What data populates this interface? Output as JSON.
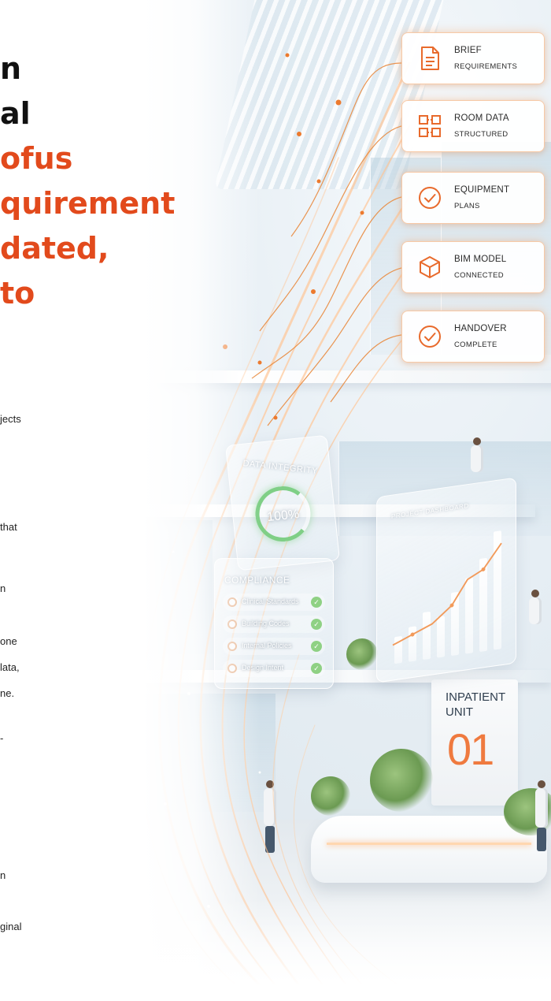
{
  "headline": {
    "lines": [
      {
        "text": "n",
        "tone": "dark"
      },
      {
        "text": "al",
        "tone": "dark"
      },
      {
        "text": "ofus",
        "tone": "orange"
      },
      {
        "text": "quirement",
        "tone": "orange"
      },
      {
        "text": "dated,",
        "tone": "orange"
      },
      {
        "text": " to",
        "tone": "orange"
      }
    ]
  },
  "body_fragments": [
    "jects",
    "that",
    "n",
    "one",
    "lata,",
    "ne.",
    "-",
    "n",
    "ginal"
  ],
  "requirement_cards": [
    {
      "title": "BRIEF",
      "subtitle": "REQUIREMENTS",
      "icon": "document-icon"
    },
    {
      "title": "ROOM DATA",
      "subtitle": "STRUCTURED",
      "icon": "room-grid-icon"
    },
    {
      "title": "EQUIPMENT",
      "subtitle": "PLANS",
      "icon": "check-circle-icon"
    },
    {
      "title": "BIM MODEL",
      "subtitle": "CONNECTED",
      "icon": "cube-icon"
    },
    {
      "title": "HANDOVER",
      "subtitle": "COMPLETE",
      "icon": "check-circle-icon"
    }
  ],
  "integrity_panel": {
    "title": "DATA INTEGRITY",
    "value": "100%"
  },
  "compliance_panel": {
    "title": "COMPLIANCE",
    "items": [
      "Clinical Standards",
      "Building Codes",
      "Internal Policies",
      "Design Intent"
    ]
  },
  "chart_panel": {
    "title": "PROJECT DASHBOARD"
  },
  "unit_sign": {
    "title": "INPATIENT UNIT",
    "number": "01"
  },
  "colors": {
    "accent": "#e24a1c",
    "card_glow": "#f7c9a6",
    "icon": "#e86a2c",
    "check": "#8fd184"
  }
}
